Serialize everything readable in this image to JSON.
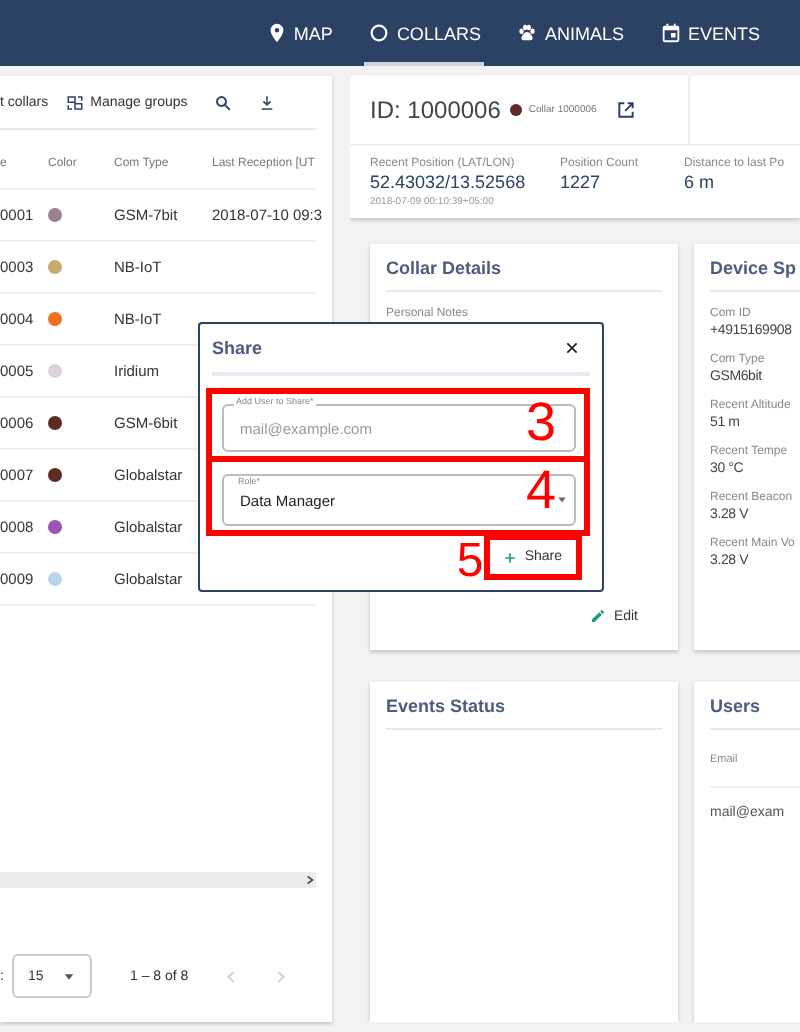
{
  "nav": [
    {
      "label": "MAP",
      "selected": false
    },
    {
      "label": "COLLARS",
      "selected": true
    },
    {
      "label": "ANIMALS",
      "selected": false
    },
    {
      "label": "EVENTS",
      "selected": false
    }
  ],
  "collar_list": {
    "toolbar": [
      "t collars",
      "Manage groups"
    ],
    "columns": [
      "e",
      "Color",
      "Com Type",
      "Last Reception [UT"
    ],
    "rows": [
      {
        "id": "0001",
        "color": "#9b8090",
        "com_type": "GSM-7bit",
        "last_reception": "2018-07-10 09:3"
      },
      {
        "id": "0003",
        "color": "#c8a96e",
        "com_type": "NB-IoT"
      },
      {
        "id": "0004",
        "color": "#f07020",
        "com_type": "NB-IoT"
      },
      {
        "id": "0005",
        "color": "#dcd2dc",
        "com_type": "Iridium"
      },
      {
        "id": "0006",
        "color": "#5c2b26",
        "com_type": "GSM-6bit"
      },
      {
        "id": "0007",
        "color": "#5c2b26",
        "com_type": "Globalstar"
      },
      {
        "id": "0008",
        "color": "#9a55b8",
        "com_type": "Globalstar"
      },
      {
        "id": "0009",
        "color": "#bcd4ec",
        "com_type": "Globalstar"
      }
    ],
    "paginator": {
      "label": ":",
      "page_size": "15",
      "range": "1 – 8 of 8"
    }
  },
  "collar": {
    "id": "ID: 1000006",
    "color": "#5c2b26",
    "name": "Collar 1000006",
    "stats": [
      {
        "label": "Recent Position (LAT/LON)",
        "value": "52.43032/13.52568",
        "note": "2018-07-09 00:10:39+05:00"
      },
      {
        "label": "Position Count",
        "value": "1227"
      },
      {
        "label": "Distance to last Po",
        "value": "6 m"
      }
    ]
  },
  "collar_details": {
    "title": "Collar Details",
    "fields": [
      "Personal Notes"
    ],
    "edit": "Edit"
  },
  "device_specs": {
    "title": "Device Sp",
    "fields": [
      {
        "label": "Com ID",
        "value": "+4915169908"
      },
      {
        "label": "Com Type",
        "value": "GSM6bit"
      },
      {
        "label": "Recent Altitude",
        "value": "51 m"
      },
      {
        "label": "Recent Tempe",
        "value": "30 °C"
      },
      {
        "label": "Recent Beacon",
        "value": "3.28 V"
      },
      {
        "label": "Recent Main Vo",
        "value": "3.28 V"
      }
    ]
  },
  "events_status": {
    "title": "Events Status"
  },
  "users": {
    "title": "Users",
    "columns": [
      "Email"
    ],
    "rows": [
      "mail@exam"
    ]
  },
  "dialog": {
    "title": "Share",
    "email_field": {
      "label": "Add User to Share*",
      "placeholder": "mail@example.com",
      "annotation": "3"
    },
    "role_field": {
      "label": "Role*",
      "value": "Data Manager",
      "annotation": "4"
    },
    "share_button": {
      "label": "Share",
      "annotation": "5"
    }
  }
}
